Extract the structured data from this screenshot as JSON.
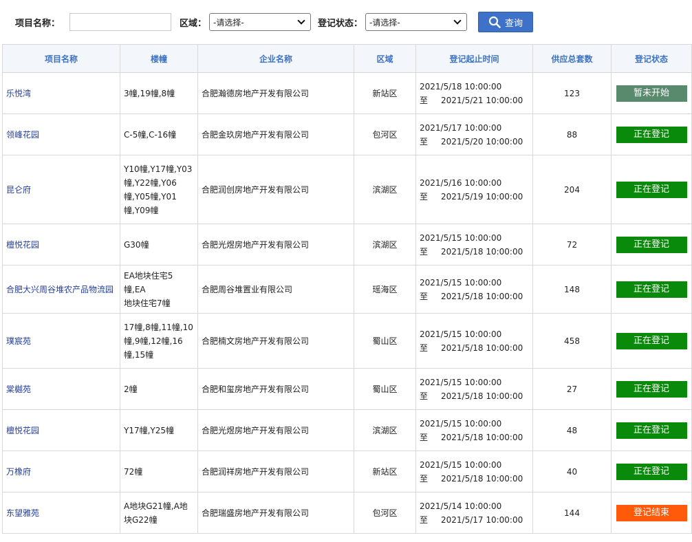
{
  "search": {
    "project_label": "项目名称：",
    "project_value": "",
    "area_label": "区域：",
    "area_selected": "-请选择-",
    "status_label": "登记状态：",
    "status_selected": "-请选择-",
    "query_label": "查询"
  },
  "colors": {
    "header_text": "#3d72c4",
    "link": "#233f9b",
    "not_started": "#5a8a6e",
    "registering": "#0a8a0a",
    "ended": "#ff5a0a",
    "button": "#3e72c8"
  },
  "table": {
    "headers": [
      "项目名称",
      "楼幢",
      "企业名称",
      "区域",
      "登记起止时间",
      "供应总套数",
      "登记状态"
    ],
    "to_word": "至",
    "rows": [
      {
        "name": "乐悦湾",
        "buildings": [
          "3幢,19幢,8幢"
        ],
        "company": "合肥瀚德房地产开发有限公司",
        "area": "新站区",
        "start": "2021/5/18 10:00:00",
        "end": "2021/5/21 10:00:00",
        "total": "123",
        "status": "暂未开始",
        "status_type": "not_started"
      },
      {
        "name": "领峰花园",
        "buildings": [
          "C-5幢,C-16幢"
        ],
        "company": "合肥金玖房地产开发有限公司",
        "area": "包河区",
        "start": "2021/5/17 10:00:00",
        "end": "2021/5/20 10:00:00",
        "total": "88",
        "status": "正在登记",
        "status_type": "registering"
      },
      {
        "name": "昆仑府",
        "buildings": [
          "Y10幢,Y17幢,Y03",
          "幢,Y22幢,Y06",
          "幢,Y05幢,Y01",
          "幢,Y09幢"
        ],
        "company": "合肥润创房地产开发有限公司",
        "area": "滨湖区",
        "start": "2021/5/16 10:00:00",
        "end": "2021/5/19 10:00:00",
        "total": "204",
        "status": "正在登记",
        "status_type": "registering"
      },
      {
        "name": "檀悦花园",
        "buildings": [
          "G30幢"
        ],
        "company": "合肥光煜房地产开发有限公司",
        "area": "滨湖区",
        "start": "2021/5/15 10:00:00",
        "end": "2021/5/18 10:00:00",
        "total": "72",
        "status": "正在登记",
        "status_type": "registering"
      },
      {
        "name": "合肥大兴周谷堆农产品物流园",
        "buildings": [
          "EA地块住宅5幢,EA",
          "地块住宅7幢"
        ],
        "company": "合肥周谷堆置业有限公司",
        "area": "瑶海区",
        "start": "2021/5/15 10:00:00",
        "end": "2021/5/18 10:00:00",
        "total": "148",
        "status": "正在登记",
        "status_type": "registering"
      },
      {
        "name": "璞宸苑",
        "buildings": [
          "17幢,8幢,11幢,10",
          "幢,9幢,12幢,16",
          "幢,15幢"
        ],
        "company": "合肥楠文房地产开发有限公司",
        "area": "蜀山区",
        "start": "2021/5/15 10:00:00",
        "end": "2021/5/18 10:00:00",
        "total": "458",
        "status": "正在登记",
        "status_type": "registering"
      },
      {
        "name": "棠樾苑",
        "buildings": [
          "2幢"
        ],
        "company": "合肥和玺房地产开发有限公司",
        "area": "蜀山区",
        "start": "2021/5/15 10:00:00",
        "end": "2021/5/18 10:00:00",
        "total": "27",
        "status": "正在登记",
        "status_type": "registering"
      },
      {
        "name": "檀悦花园",
        "buildings": [
          "Y17幢,Y25幢"
        ],
        "company": "合肥光煜房地产开发有限公司",
        "area": "滨湖区",
        "start": "2021/5/15 10:00:00",
        "end": "2021/5/18 10:00:00",
        "total": "48",
        "status": "正在登记",
        "status_type": "registering"
      },
      {
        "name": "万橡府",
        "buildings": [
          "72幢"
        ],
        "company": "合肥润祥房地产开发有限公司",
        "area": "新站区",
        "start": "2021/5/15 10:00:00",
        "end": "2021/5/18 10:00:00",
        "total": "40",
        "status": "正在登记",
        "status_type": "registering"
      },
      {
        "name": "东望雅苑",
        "buildings": [
          "A地块G21幢,A地",
          "块G22幢"
        ],
        "company": "合肥瑞盛房地产开发有限公司",
        "area": "包河区",
        "start": "2021/5/14 10:00:00",
        "end": "2021/5/17 10:00:00",
        "total": "144",
        "status": "登记结束",
        "status_type": "ended"
      }
    ]
  }
}
